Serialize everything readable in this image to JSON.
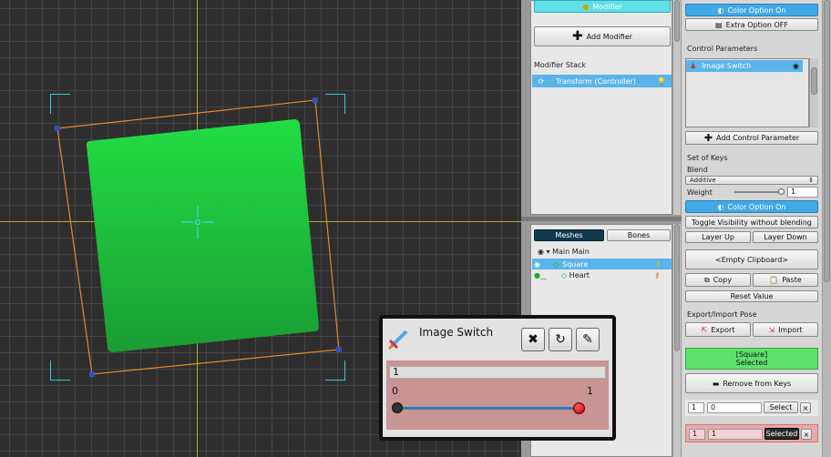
{
  "viewport": {
    "mesh_color_top": "#22dd44",
    "mesh_color_bottom": "#1a9d34",
    "frame_color": "#e08a2a",
    "handle_color": "#2f4fb8"
  },
  "mid_panel": {
    "modifier_button": "Modifier",
    "add_modifier": "Add Modifier",
    "modifier_stack_label": "Modifier Stack",
    "modifier_item": "Transform (Controller)",
    "tabs": {
      "meshes": "Meshes",
      "bones": "Bones"
    },
    "tree": {
      "root": "Main Main",
      "square": "Square",
      "heart": "Heart"
    }
  },
  "right_panel": {
    "color_option": "Color Option On",
    "extra_option": "Extra Option OFF",
    "control_params_label": "Control Parameters",
    "param_item": "Image Switch",
    "add_control_param": "Add Control Parameter",
    "set_of_keys": "Set of Keys",
    "blend_label": "Blend",
    "blend_value": "Additive",
    "weight_label": "Weight",
    "weight_value": "1",
    "color_option_2": "Color Option On",
    "toggle_visibility": "Toggle Visibility without blending",
    "layer_up": "Layer Up",
    "layer_down": "Layer Down",
    "clipboard": "<Empty Clipboard>",
    "copy": "Copy",
    "paste": "Paste",
    "reset_value": "Reset Value",
    "export_import_label": "Export/Import Pose",
    "export": "Export",
    "import": "Import",
    "selected_name": "[Square]",
    "selected_state": "Selected",
    "remove_from_keys": "Remove from Keys",
    "key_rows": [
      {
        "index": "1",
        "value": "0",
        "button": "Select",
        "close": "×"
      },
      {
        "index": "1",
        "value": "1",
        "button": "Selected",
        "close": "×"
      }
    ]
  },
  "popup": {
    "title": "Image Switch",
    "value": "1",
    "slider_min": "0",
    "slider_max": "1",
    "slider_level": 1.0,
    "buttons": {
      "close": "✖",
      "reset": "↻",
      "edit": "✎"
    }
  }
}
